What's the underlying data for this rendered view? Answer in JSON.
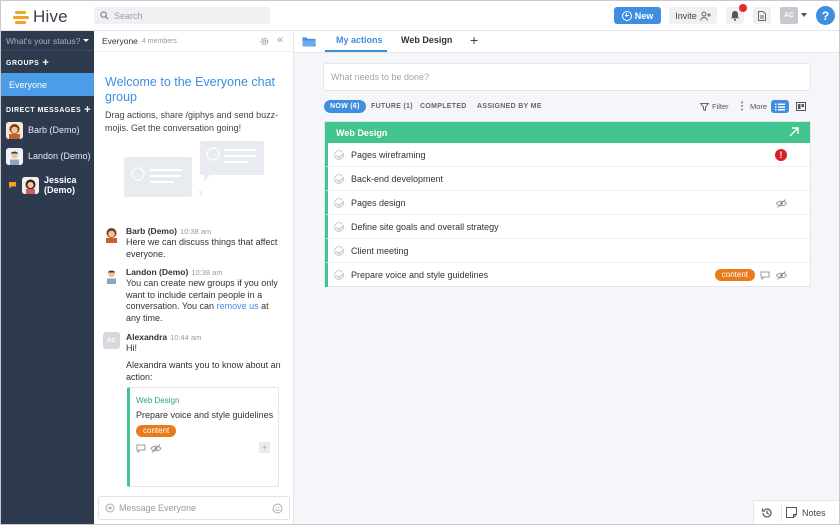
{
  "app": {
    "name": "Hive"
  },
  "topbar": {
    "search_placeholder": "Search",
    "new_label": "New",
    "invite_label": "Invite",
    "avatar_initials": "AC",
    "help_label": "?"
  },
  "sidebar": {
    "status_placeholder": "What's your status?",
    "groups_header": "GROUPS",
    "groups": [
      {
        "label": "Everyone"
      }
    ],
    "dm_header": "DIRECT MESSAGES",
    "dms": [
      {
        "label": "Barb (Demo)"
      },
      {
        "label": "Landon (Demo)"
      },
      {
        "label": "Jessica (Demo)"
      }
    ]
  },
  "chat": {
    "title": "Everyone",
    "members": "4 members",
    "welcome_title": "Welcome to the Everyone chat group",
    "welcome_body": "Drag actions, share /giphys and send buzz-mojis. Get the conversation going!",
    "messages": [
      {
        "name": "Barb (Demo)",
        "time": "10:38 am",
        "text": "Here we can discuss things that affect everyone."
      },
      {
        "name": "Landon (Demo)",
        "time": "10:38 am",
        "text": "You can create new groups if you only want to include certain people in a conversation. You can ",
        "link": "remove us",
        "text_after": " at any time."
      },
      {
        "name": "Alexandra",
        "time": "10:44 am",
        "initials": "AC",
        "text": "Hi!",
        "text2": "Alexandra wants you to know about an action:"
      }
    ],
    "card": {
      "project": "Web Design",
      "title": "Prepare voice and style guidelines",
      "tag": "content"
    },
    "input_placeholder": "Message Everyone"
  },
  "main": {
    "tabs": [
      {
        "label": "My actions"
      },
      {
        "label": "Web Design"
      }
    ],
    "add_tab": "+",
    "todo_placeholder": "What needs to be done?",
    "filters": [
      {
        "label": "NOW (6)"
      },
      {
        "label": "FUTURE (1)"
      },
      {
        "label": "COMPLETED"
      },
      {
        "label": "ASSIGNED BY ME"
      }
    ],
    "filter_label": "Filter",
    "more_label": "More",
    "project": {
      "name": "Web Design",
      "color": "#42c48e",
      "tasks": [
        {
          "title": "Pages wireframing",
          "alert": "!"
        },
        {
          "title": "Back-end development"
        },
        {
          "title": "Pages design"
        },
        {
          "title": "Define site goals and overall strategy"
        },
        {
          "title": "Client meeting"
        },
        {
          "title": "Prepare voice and style guidelines",
          "tag": "content"
        }
      ]
    },
    "notes_label": "Notes"
  }
}
